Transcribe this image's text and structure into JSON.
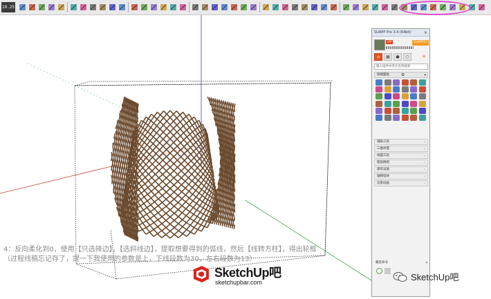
{
  "toolbar": {
    "counter": "19.25"
  },
  "panel": {
    "title": "SUAPP Pro 3.4 (64bit)",
    "close": "×",
    "vip": "VIP",
    "suapp_label": "SUAPP24",
    "search_placeholder": "输入插件中英文名称搜索",
    "quick_header": "快捷面板",
    "categories": [
      "辅助工具",
      "三维体量",
      "线面工具",
      "图层群组",
      "建筑设施",
      "轴网墙体",
      "渲染动画"
    ],
    "recent": "最近命令"
  },
  "caption": {
    "line1": "4：反向柔化到0，使用【只选择边】，【选斜线边】，提取想要得到的弧线，然后【线转方柱】，得出轮框",
    "line2": "（过程线稿忘记存了，提一下我使用的参数是上，下线段数为30，左右段数为13）"
  },
  "watermark": {
    "main": "SketchUp吧",
    "sub": "sketchupbar.com"
  },
  "wechat": {
    "label": "SketchUp吧"
  },
  "colors": {
    "mesh": "#6b4a2e",
    "highlight": "#e54ad0",
    "axis_red": "#d23c3c",
    "axis_green": "#3fa34a",
    "axis_blue": "#3a3ad0"
  }
}
